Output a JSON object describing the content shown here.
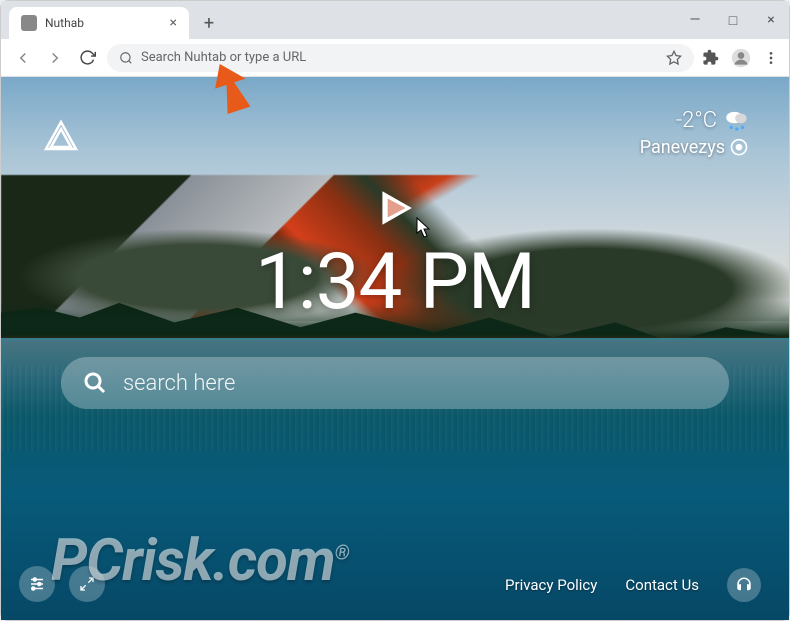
{
  "browser": {
    "tab_title": "Nuthab",
    "omnibox_placeholder": "Search Nuhtab or type a URL"
  },
  "page": {
    "weather": {
      "temp": "-2°C",
      "location": "Panevezys"
    },
    "clock": "1:34 PM",
    "search_placeholder": "search here",
    "footer": {
      "privacy": "Privacy Policy",
      "contact": "Contact Us"
    }
  },
  "watermark": {
    "text": "PCrisk.com",
    "registered": "®"
  },
  "colors": {
    "accent_orange": "#e85a1a",
    "lake": "#0a6888"
  }
}
